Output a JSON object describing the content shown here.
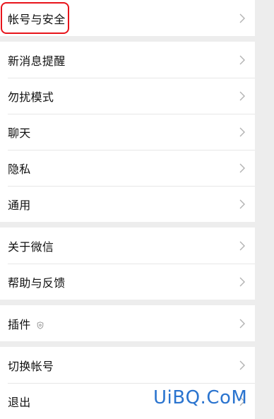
{
  "settings": {
    "group1": [
      {
        "label": "帐号与安全"
      }
    ],
    "group2": [
      {
        "label": "新消息提醒"
      },
      {
        "label": "勿扰模式"
      },
      {
        "label": "聊天"
      },
      {
        "label": "隐私"
      },
      {
        "label": "通用"
      }
    ],
    "group3": [
      {
        "label": "关于微信"
      },
      {
        "label": "帮助与反馈"
      }
    ],
    "group4": [
      {
        "label": "插件",
        "icon": "shield-icon"
      }
    ],
    "group5": [
      {
        "label": "切换帐号"
      },
      {
        "label": "退出"
      }
    ]
  },
  "watermark": "UiBQ.CoM",
  "colors": {
    "background": "#ededed",
    "row_background": "#ffffff",
    "highlight_border": "#e8141b",
    "watermark": "#2a74cf"
  }
}
